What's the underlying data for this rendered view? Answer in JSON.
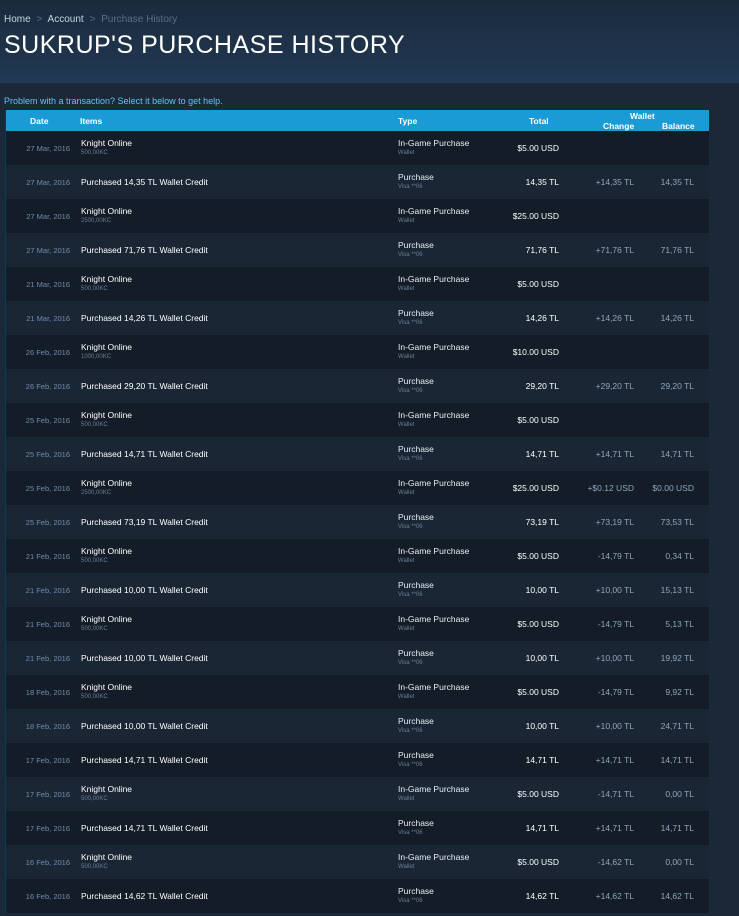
{
  "breadcrumb": {
    "items": [
      "Home",
      "Account"
    ],
    "current": "Purchase History",
    "separator": ">"
  },
  "page_title": "SUKRUP'S PURCHASE HISTORY",
  "help_text": "Problem with a transaction? Select it below to get help.",
  "table": {
    "headers": {
      "date": "Date",
      "items": "Items",
      "type": "Type",
      "total": "Total",
      "wallet": "Wallet",
      "change": "Change",
      "balance": "Balance"
    },
    "rows": [
      {
        "date": "27 Mar, 2016",
        "item": "Knight Online",
        "item_sub": "500,00KC",
        "type": "In-Game Purchase",
        "type_sub": "Wallet",
        "total": "$5.00 USD",
        "change": "",
        "balance": ""
      },
      {
        "date": "27 Mar, 2016",
        "item": "Purchased 14,35 TL Wallet Credit",
        "item_sub": "",
        "type": "Purchase",
        "type_sub": "Visa **06",
        "total": "14,35 TL",
        "change": "+14,35 TL",
        "balance": "14,35 TL"
      },
      {
        "date": "27 Mar, 2016",
        "item": "Knight Online",
        "item_sub": "2500,00KC",
        "type": "In-Game Purchase",
        "type_sub": "Wallet",
        "total": "$25.00 USD",
        "change": "",
        "balance": ""
      },
      {
        "date": "27 Mar, 2016",
        "item": "Purchased 71,76 TL Wallet Credit",
        "item_sub": "",
        "type": "Purchase",
        "type_sub": "Visa **06",
        "total": "71,76 TL",
        "change": "+71,76 TL",
        "balance": "71,76 TL"
      },
      {
        "date": "21 Mar, 2016",
        "item": "Knight Online",
        "item_sub": "500,00KC",
        "type": "In-Game Purchase",
        "type_sub": "Wallet",
        "total": "$5.00 USD",
        "change": "",
        "balance": ""
      },
      {
        "date": "21 Mar, 2016",
        "item": "Purchased 14,26 TL Wallet Credit",
        "item_sub": "",
        "type": "Purchase",
        "type_sub": "Visa **06",
        "total": "14,26 TL",
        "change": "+14,26 TL",
        "balance": "14,26 TL"
      },
      {
        "date": "26 Feb, 2016",
        "item": "Knight Online",
        "item_sub": "1000,00KC",
        "type": "In-Game Purchase",
        "type_sub": "Wallet",
        "total": "$10.00 USD",
        "change": "",
        "balance": ""
      },
      {
        "date": "26 Feb, 2016",
        "item": "Purchased 29,20 TL Wallet Credit",
        "item_sub": "",
        "type": "Purchase",
        "type_sub": "Visa **06",
        "total": "29,20 TL",
        "change": "+29,20 TL",
        "balance": "29,20 TL"
      },
      {
        "date": "25 Feb, 2016",
        "item": "Knight Online",
        "item_sub": "500,00KC",
        "type": "In-Game Purchase",
        "type_sub": "Wallet",
        "total": "$5.00 USD",
        "change": "",
        "balance": ""
      },
      {
        "date": "25 Feb, 2016",
        "item": "Purchased 14,71 TL Wallet Credit",
        "item_sub": "",
        "type": "Purchase",
        "type_sub": "Visa **06",
        "total": "14,71 TL",
        "change": "+14,71 TL",
        "balance": "14,71 TL"
      },
      {
        "date": "25 Feb, 2016",
        "item": "Knight Online",
        "item_sub": "2500,00KC",
        "type": "In-Game Purchase",
        "type_sub": "Wallet",
        "total": "$25.00 USD",
        "change": "+$0.12 USD",
        "balance": "$0.00 USD"
      },
      {
        "date": "25 Feb, 2016",
        "item": "Purchased 73,19 TL Wallet Credit",
        "item_sub": "",
        "type": "Purchase",
        "type_sub": "Visa **06",
        "total": "73,19 TL",
        "change": "+73,19 TL",
        "balance": "73,53 TL"
      },
      {
        "date": "21 Feb, 2016",
        "item": "Knight Online",
        "item_sub": "500,00KC",
        "type": "In-Game Purchase",
        "type_sub": "Wallet",
        "total": "$5.00 USD",
        "change": "-14,79 TL",
        "balance": "0,34 TL"
      },
      {
        "date": "21 Feb, 2016",
        "item": "Purchased 10,00 TL Wallet Credit",
        "item_sub": "",
        "type": "Purchase",
        "type_sub": "Visa **06",
        "total": "10,00 TL",
        "change": "+10,00 TL",
        "balance": "15,13 TL"
      },
      {
        "date": "21 Feb, 2016",
        "item": "Knight Online",
        "item_sub": "500,00KC",
        "type": "In-Game Purchase",
        "type_sub": "Wallet",
        "total": "$5.00 USD",
        "change": "-14,79 TL",
        "balance": "5,13 TL"
      },
      {
        "date": "21 Feb, 2016",
        "item": "Purchased 10,00 TL Wallet Credit",
        "item_sub": "",
        "type": "Purchase",
        "type_sub": "Visa **06",
        "total": "10,00 TL",
        "change": "+10,00 TL",
        "balance": "19,92 TL"
      },
      {
        "date": "18 Feb, 2016",
        "item": "Knight Online",
        "item_sub": "500,00KC",
        "type": "In-Game Purchase",
        "type_sub": "Wallet",
        "total": "$5.00 USD",
        "change": "-14,79 TL",
        "balance": "9,92 TL"
      },
      {
        "date": "18 Feb, 2016",
        "item": "Purchased 10,00 TL Wallet Credit",
        "item_sub": "",
        "type": "Purchase",
        "type_sub": "Visa **06",
        "total": "10,00 TL",
        "change": "+10,00 TL",
        "balance": "24,71 TL"
      },
      {
        "date": "17 Feb, 2016",
        "item": "Purchased 14,71 TL Wallet Credit",
        "item_sub": "",
        "type": "Purchase",
        "type_sub": "Visa **06",
        "total": "14,71 TL",
        "change": "+14,71 TL",
        "balance": "14,71 TL"
      },
      {
        "date": "17 Feb, 2016",
        "item": "Knight Online",
        "item_sub": "500,00KC",
        "type": "In-Game Purchase",
        "type_sub": "Wallet",
        "total": "$5.00 USD",
        "change": "-14,71 TL",
        "balance": "0,00 TL"
      },
      {
        "date": "17 Feb, 2016",
        "item": "Purchased 14,71 TL Wallet Credit",
        "item_sub": "",
        "type": "Purchase",
        "type_sub": "Visa **06",
        "total": "14,71 TL",
        "change": "+14,71 TL",
        "balance": "14,71 TL"
      },
      {
        "date": "16 Feb, 2016",
        "item": "Knight Online",
        "item_sub": "500,00KC",
        "type": "In-Game Purchase",
        "type_sub": "Wallet",
        "total": "$5.00 USD",
        "change": "-14,62 TL",
        "balance": "0,00 TL"
      },
      {
        "date": "16 Feb, 2016",
        "item": "Purchased 14,62 TL Wallet Credit",
        "item_sub": "",
        "type": "Purchase",
        "type_sub": "Visa **06",
        "total": "14,62 TL",
        "change": "+14,62 TL",
        "balance": "14,62 TL"
      }
    ]
  }
}
